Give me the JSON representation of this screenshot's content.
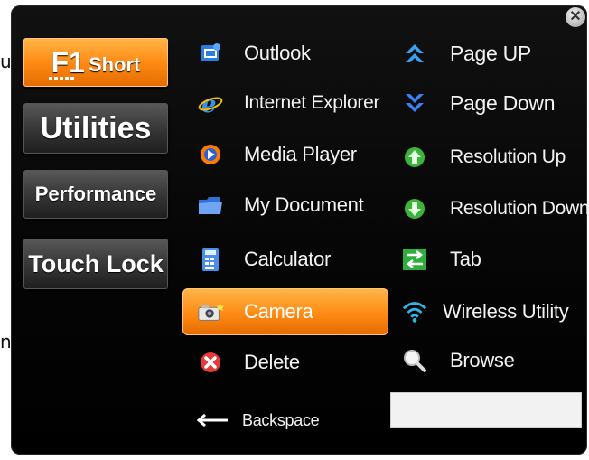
{
  "edge": {
    "top_char": "u",
    "middle_char": "n"
  },
  "close": {
    "glyph": "✕"
  },
  "sidebar": {
    "f1_main": "F1",
    "f1_sub": "Short",
    "utilities": "Utilities",
    "performance": "Performance",
    "touch_lock": "Touch Lock"
  },
  "shortcuts_left": [
    {
      "label": "Outlook",
      "icon": "outlook-icon"
    },
    {
      "label": "Internet Explorer",
      "icon": "internet-explorer-icon"
    },
    {
      "label": "Media Player",
      "icon": "media-player-icon"
    },
    {
      "label": "My Document",
      "icon": "folder-icon"
    },
    {
      "label": "Calculator",
      "icon": "calculator-icon"
    },
    {
      "label": "Camera",
      "icon": "camera-icon"
    },
    {
      "label": "Delete",
      "icon": "delete-icon"
    },
    {
      "label": "Backspace",
      "icon": "backspace-arrow-icon"
    }
  ],
  "shortcuts_right": [
    {
      "label": "Page UP",
      "icon": "page-up-icon"
    },
    {
      "label": "Page Down",
      "icon": "page-down-icon"
    },
    {
      "label": "Resolution Up",
      "icon": "resolution-up-icon"
    },
    {
      "label": "Resolution Down",
      "icon": "resolution-down-icon"
    },
    {
      "label": "Tab",
      "icon": "tab-icon"
    },
    {
      "label": "Wireless Utility",
      "icon": "wireless-icon"
    },
    {
      "label": "Browse",
      "icon": "magnifier-icon"
    }
  ],
  "browse_input": {
    "value": ""
  },
  "colors": {
    "accent": "#ff8b14",
    "panel": "#0a0a0a",
    "button_gray": "#3a3a3a"
  }
}
